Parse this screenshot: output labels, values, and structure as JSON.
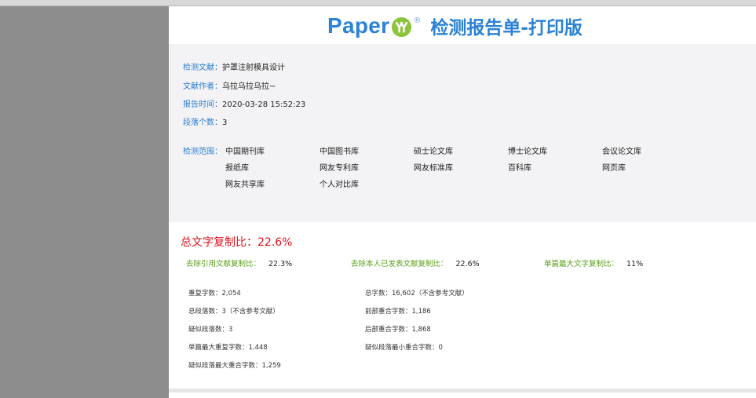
{
  "brand": {
    "name": "Paper",
    "reg_mark": "®",
    "report_title": "检测报告单-打印版",
    "color": "#2b82d4"
  },
  "info": {
    "doc_label": "检测文献：",
    "doc_value": "护罩注射模具设计",
    "author_label": "文献作者：",
    "author_value": "乌拉乌拉乌拉~",
    "time_label": "报告时间：",
    "time_value": "2020-03-28 15:52:23",
    "para_label": "段落个数：",
    "para_value": "3"
  },
  "scope": {
    "label": "检测范围：",
    "items": [
      "中国期刊库",
      "中国图书库",
      "硕士论文库",
      "博士论文库",
      "会议论文库",
      "报纸库",
      "网友专利库",
      "网友标准库",
      "百科库",
      "网页库",
      "网友共享库",
      "个人对比库"
    ]
  },
  "summary": {
    "total_label": "总文字复制比：",
    "total_value": "22.6%",
    "sub": [
      {
        "label": "去除引用文献复制比：",
        "value": "22.3%"
      },
      {
        "label": "去除本人已发表文献复制比：",
        "value": "22.6%"
      },
      {
        "label": "单篇最大文字复制比：",
        "value": "11%"
      }
    ]
  },
  "stats": [
    "重复字数：2,054",
    "总字数：16,602（不含参考文献）",
    "总段落数：3（不含参考文献）",
    "前部重合字数：1,186",
    "疑似段落数：3",
    "后部重合字数：1,868",
    "单篇最大重复字数：1,448",
    "疑似段落最小重合字数：0",
    "疑似段落最大重合字数：1,259"
  ],
  "colors": {
    "label_blue": "#2b7cd1",
    "total_red": "#e0101b",
    "sub_green": "#5a9e1a",
    "panel_bg": "#f3f3f5"
  }
}
